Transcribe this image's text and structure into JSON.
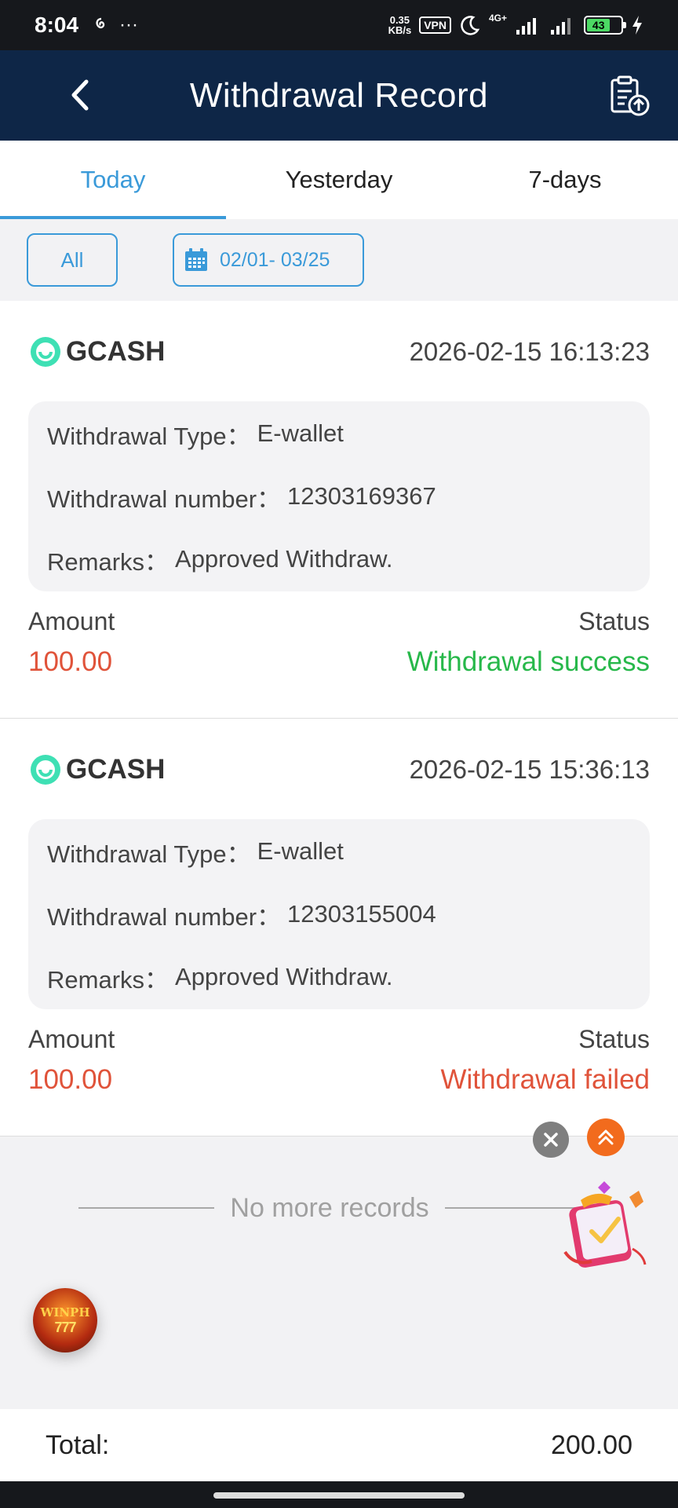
{
  "status_bar": {
    "time": "8:04",
    "left_extra": "···",
    "net_speed_value": "0.35",
    "net_speed_unit": "KB/s",
    "vpn": "VPN",
    "network": "4G+",
    "battery": "43",
    "battery_level": 0.43
  },
  "header": {
    "title": "Withdrawal Record"
  },
  "tabs": [
    {
      "label": "Today",
      "active": true
    },
    {
      "label": "Yesterday",
      "active": false
    },
    {
      "label": "7-days",
      "active": false
    }
  ],
  "filters": {
    "all_label": "All",
    "date_range": "02/01- 03/25"
  },
  "records": [
    {
      "provider": "GCASH",
      "datetime": "2026-02-15 16:13:23",
      "type_label": "Withdrawal Type：",
      "type_value": "E-wallet",
      "number_label": "Withdrawal number：",
      "number_value": "12303169367",
      "remarks_label": "Remarks：",
      "remarks_value": "Approved Withdraw.",
      "amount_label": "Amount",
      "amount_value": "100.00",
      "status_label": "Status",
      "status_value": "Withdrawal success",
      "status_color": "#27b84a"
    },
    {
      "provider": "GCASH",
      "datetime": "2026-02-15 15:36:13",
      "type_label": "Withdrawal Type：",
      "type_value": "E-wallet",
      "number_label": "Withdrawal number：",
      "number_value": "12303155004",
      "remarks_label": "Remarks：",
      "remarks_value": "Approved Withdraw.",
      "amount_label": "Amount",
      "amount_value": "100.00",
      "status_label": "Status",
      "status_value": "Withdrawal failed",
      "status_color": "#e0533a"
    }
  ],
  "end_message": "No more records",
  "floating": {
    "close_icon": "close-icon",
    "scroll_top_icon": "double-chevron-up-icon",
    "promo_icon": "gift-box-icon",
    "game_bubble_brand": "WINPH",
    "game_bubble_sub": "777"
  },
  "total": {
    "label": "Total:",
    "value": "200.00"
  },
  "colors": {
    "header_bg": "#0e2647",
    "accent": "#3a9ad9",
    "amount": "#e0533a",
    "success": "#27b84a",
    "failed": "#e0533a"
  }
}
